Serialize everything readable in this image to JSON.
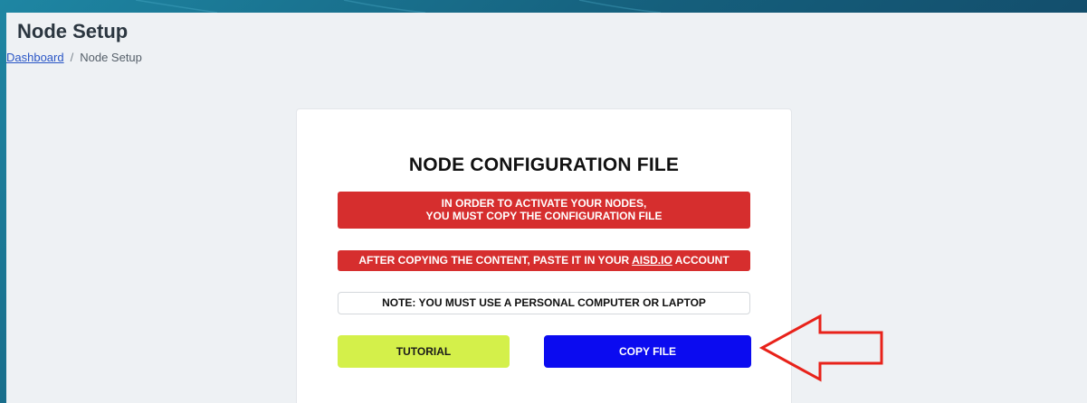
{
  "page": {
    "title": "Node Setup"
  },
  "breadcrumb": {
    "home_label": "Dashboard",
    "separator": "/",
    "current_label": "Node Setup"
  },
  "card": {
    "title": "NODE CONFIGURATION FILE",
    "alert_line1": "IN ORDER TO ACTIVATE YOUR NODES,",
    "alert_line2": "YOU MUST COPY THE CONFIGURATION FILE",
    "paste_prefix": "AFTER COPYING THE CONTENT, PASTE IT IN YOUR ",
    "paste_link": "AISD.IO",
    "paste_suffix": " ACCOUNT",
    "note": "NOTE: YOU MUST USE A PERSONAL COMPUTER OR LAPTOP",
    "tutorial_label": "TUTORIAL",
    "copy_label": "COPY FILE"
  },
  "colors": {
    "alert_red": "#d62e2e",
    "tutorial_green": "#d4f04a",
    "copy_blue": "#0b0bf0",
    "annotation_arrow": "#e8221a"
  },
  "icons": {
    "annotation": "left-arrow-outline-icon"
  }
}
